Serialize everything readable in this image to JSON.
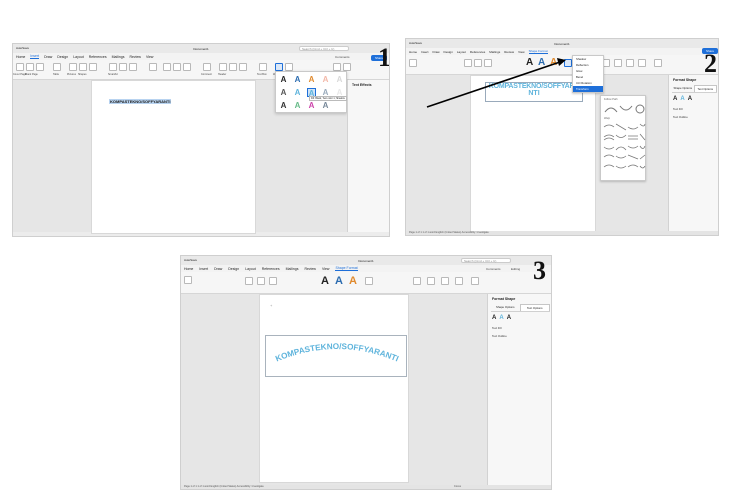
{
  "window": {
    "autosave": "AutoSave",
    "doc_title": "Document1",
    "search_placeholder": "Search (Cmd + Ctrl + U)"
  },
  "step_badges": [
    "1",
    "2",
    "3"
  ],
  "panel1": {
    "tabs": [
      "Home",
      "Insert",
      "Draw",
      "Design",
      "Layout",
      "References",
      "Mailings",
      "Review",
      "View"
    ],
    "active_tab": "Insert",
    "ribbon_groups": [
      "Cover Page",
      "Blank Page",
      "Page Break",
      "Table",
      "Pictures",
      "Shapes",
      "Icons",
      "3D Models",
      "SmartArt",
      "Chart",
      "Screenshot",
      "Media",
      "Link",
      "Bookmark",
      "Cross-reference",
      "Comment",
      "Header",
      "Footer",
      "Page Number",
      "Text Box",
      "WordArt",
      "Drop Cap",
      "Equation",
      "Symbol"
    ],
    "comments": "Comments",
    "editing": "Editing",
    "share": "Share",
    "body_text": "KOMPASTEKNO/SOFFYARANTI",
    "gallery_tooltip": "Fill: Black, Text color 1; Shadow",
    "pane_title": "Text Effects"
  },
  "panel2": {
    "tabs": [
      "Home",
      "Insert",
      "Draw",
      "Design",
      "Layout",
      "References",
      "Mailings",
      "Review",
      "View",
      "Shape Format"
    ],
    "active_tab": "Shape Format",
    "wordart_text_line1": "KOMPASTEKNO/SOFFYARA",
    "wordart_text_line2": "NTI",
    "effects_menu": [
      "Shadow",
      "Reflection",
      "Glow",
      "Bevel",
      "3-D Rotation",
      "Transform"
    ],
    "highlighted_effect": "Transform",
    "warp_headers": [
      "Follow Path",
      "Warp"
    ],
    "pane_title": "Format Shape",
    "pane_tabs": [
      "Shape Options",
      "Text Options"
    ],
    "pane_rows": [
      "Text Fill",
      "Text Outline"
    ],
    "status": "Page 1 of 1   1 of 1 word   English (United States)   Accessibility: Investigate"
  },
  "panel3": {
    "tabs": [
      "Home",
      "Insert",
      "Draw",
      "Design",
      "Layout",
      "References",
      "Mailings",
      "Review",
      "View",
      "Shape Format"
    ],
    "active_tab": "Shape Format",
    "wordart_text": "KOMPASTEKNO/SOFFYARANTI",
    "comments": "Comments",
    "editing": "Editing",
    "pane_title": "Format Shape",
    "pane_tabs": [
      "Shape Options",
      "Text Options"
    ],
    "pane_rows": [
      "Text Fill",
      "Text Outline"
    ],
    "status": "Page 1 of 1   1 of 1 word   English (United States)   Accessibility: Investigate",
    "zoom": "Focus"
  },
  "colors": {
    "accent": "#1e6fd9",
    "wordart": "#5fb4dc",
    "highlight": "#b8d3f0"
  }
}
